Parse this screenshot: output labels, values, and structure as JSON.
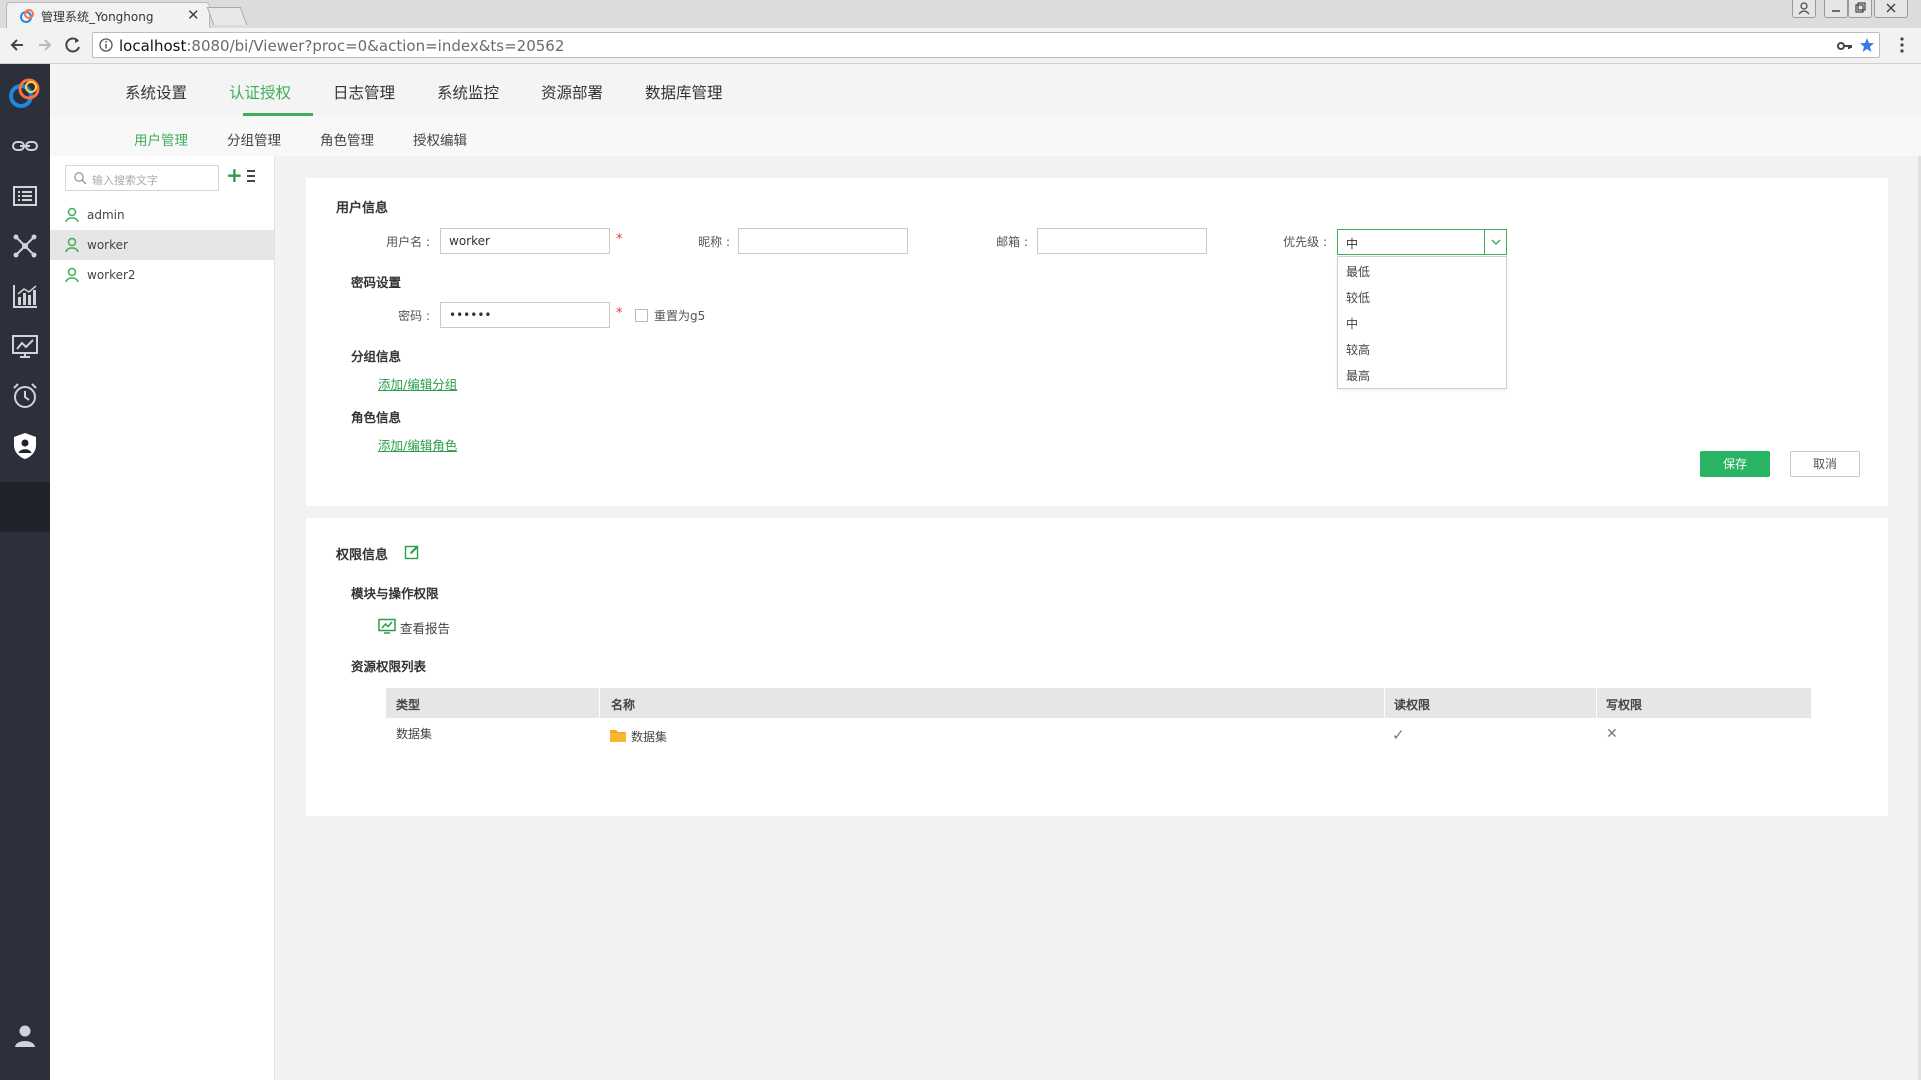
{
  "browser": {
    "tab_title": "管理系统_Yonghong",
    "tab_close": "✕",
    "url_host": "localhost",
    "url_path": ":8080/bi/Viewer?proc=0&action=index&ts=20562"
  },
  "topnav": {
    "items": [
      "系统设置",
      "认证授权",
      "日志管理",
      "系统监控",
      "资源部署",
      "数据库管理"
    ],
    "active": "认证授权"
  },
  "subnav": {
    "items": [
      "用户管理",
      "分组管理",
      "角色管理",
      "授权编辑"
    ],
    "active": "用户管理"
  },
  "userlist": {
    "search_placeholder": "输入搜索文字",
    "add": "+",
    "users": [
      "admin",
      "worker",
      "worker2"
    ],
    "selected": "worker"
  },
  "userinfo": {
    "title": "用户信息",
    "username_label": "用户名 :",
    "username_value": "worker",
    "required_mark": "*",
    "nickname_label": "昵称 :",
    "email_label": "邮箱 :",
    "priority_label": "优先级 :",
    "priority_value": "中",
    "priority_options": [
      "最低",
      "较低",
      "中",
      "较高",
      "最高"
    ],
    "password_section": "密码设置",
    "password_label": "密码 :",
    "password_value": "••••••",
    "reset_label": "重置为g5",
    "group_section": "分组信息",
    "group_link": "添加/编辑分组",
    "role_section": "角色信息",
    "role_link": "添加/编辑角色",
    "save": "保存",
    "cancel": "取消"
  },
  "permission": {
    "title": "权限信息",
    "module_section": "模块与操作权限",
    "module_item": "查看报告",
    "resource_section": "资源权限列表",
    "columns": [
      "类型",
      "名称",
      "读权限",
      "写权限"
    ],
    "rows": [
      {
        "type": "数据集",
        "name": "数据集",
        "read": "✓",
        "write": "✕"
      }
    ]
  },
  "colors": {
    "accent": "#3fae5b",
    "save_button": "#28b463",
    "rail": "#2b303b"
  }
}
